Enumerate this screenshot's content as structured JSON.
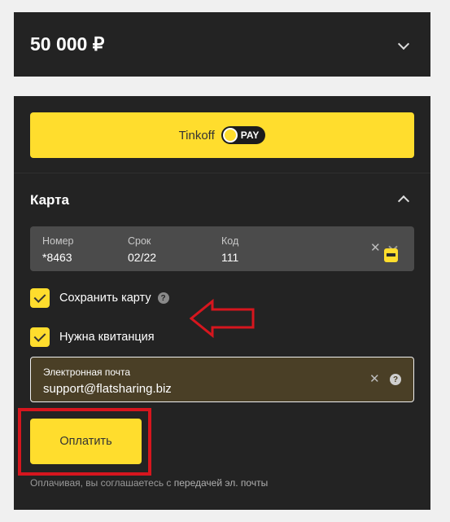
{
  "amount_panel": {
    "amount": "50 000 ₽"
  },
  "tinkoff_pay": {
    "label": "Tinkoff",
    "badge": "PAY"
  },
  "card_section": {
    "title": "Карта",
    "number_label": "Номер",
    "number_value": "*8463",
    "expiry_label": "Срок",
    "expiry_value": "02/22",
    "code_label": "Код",
    "code_value": "111",
    "clear_symbol": "✕"
  },
  "save_card": {
    "label": "Сохранить карту",
    "help": "?",
    "checked": true
  },
  "need_receipt": {
    "label": "Нужна квитанция",
    "checked": true
  },
  "email": {
    "label": "Электронная почта",
    "value": "support@flatsharing.biz",
    "clear_symbol": "✕",
    "help": "?"
  },
  "pay_button": {
    "label": "Оплатить"
  },
  "consent": {
    "text": "Оплачивая, вы соглашаетесь с ",
    "link": "передачей эл. почты"
  },
  "colors": {
    "panel": "#232323",
    "accent": "#ffdd2d",
    "annotation": "#d6161e",
    "page": "#f0f0f0"
  },
  "icons": [
    "chevron-down-icon",
    "chevron-up-icon",
    "tinkoff-pay-logo-icon",
    "clear-icon",
    "card-icon",
    "help-icon",
    "check-icon",
    "red-arrow-annotation"
  ]
}
